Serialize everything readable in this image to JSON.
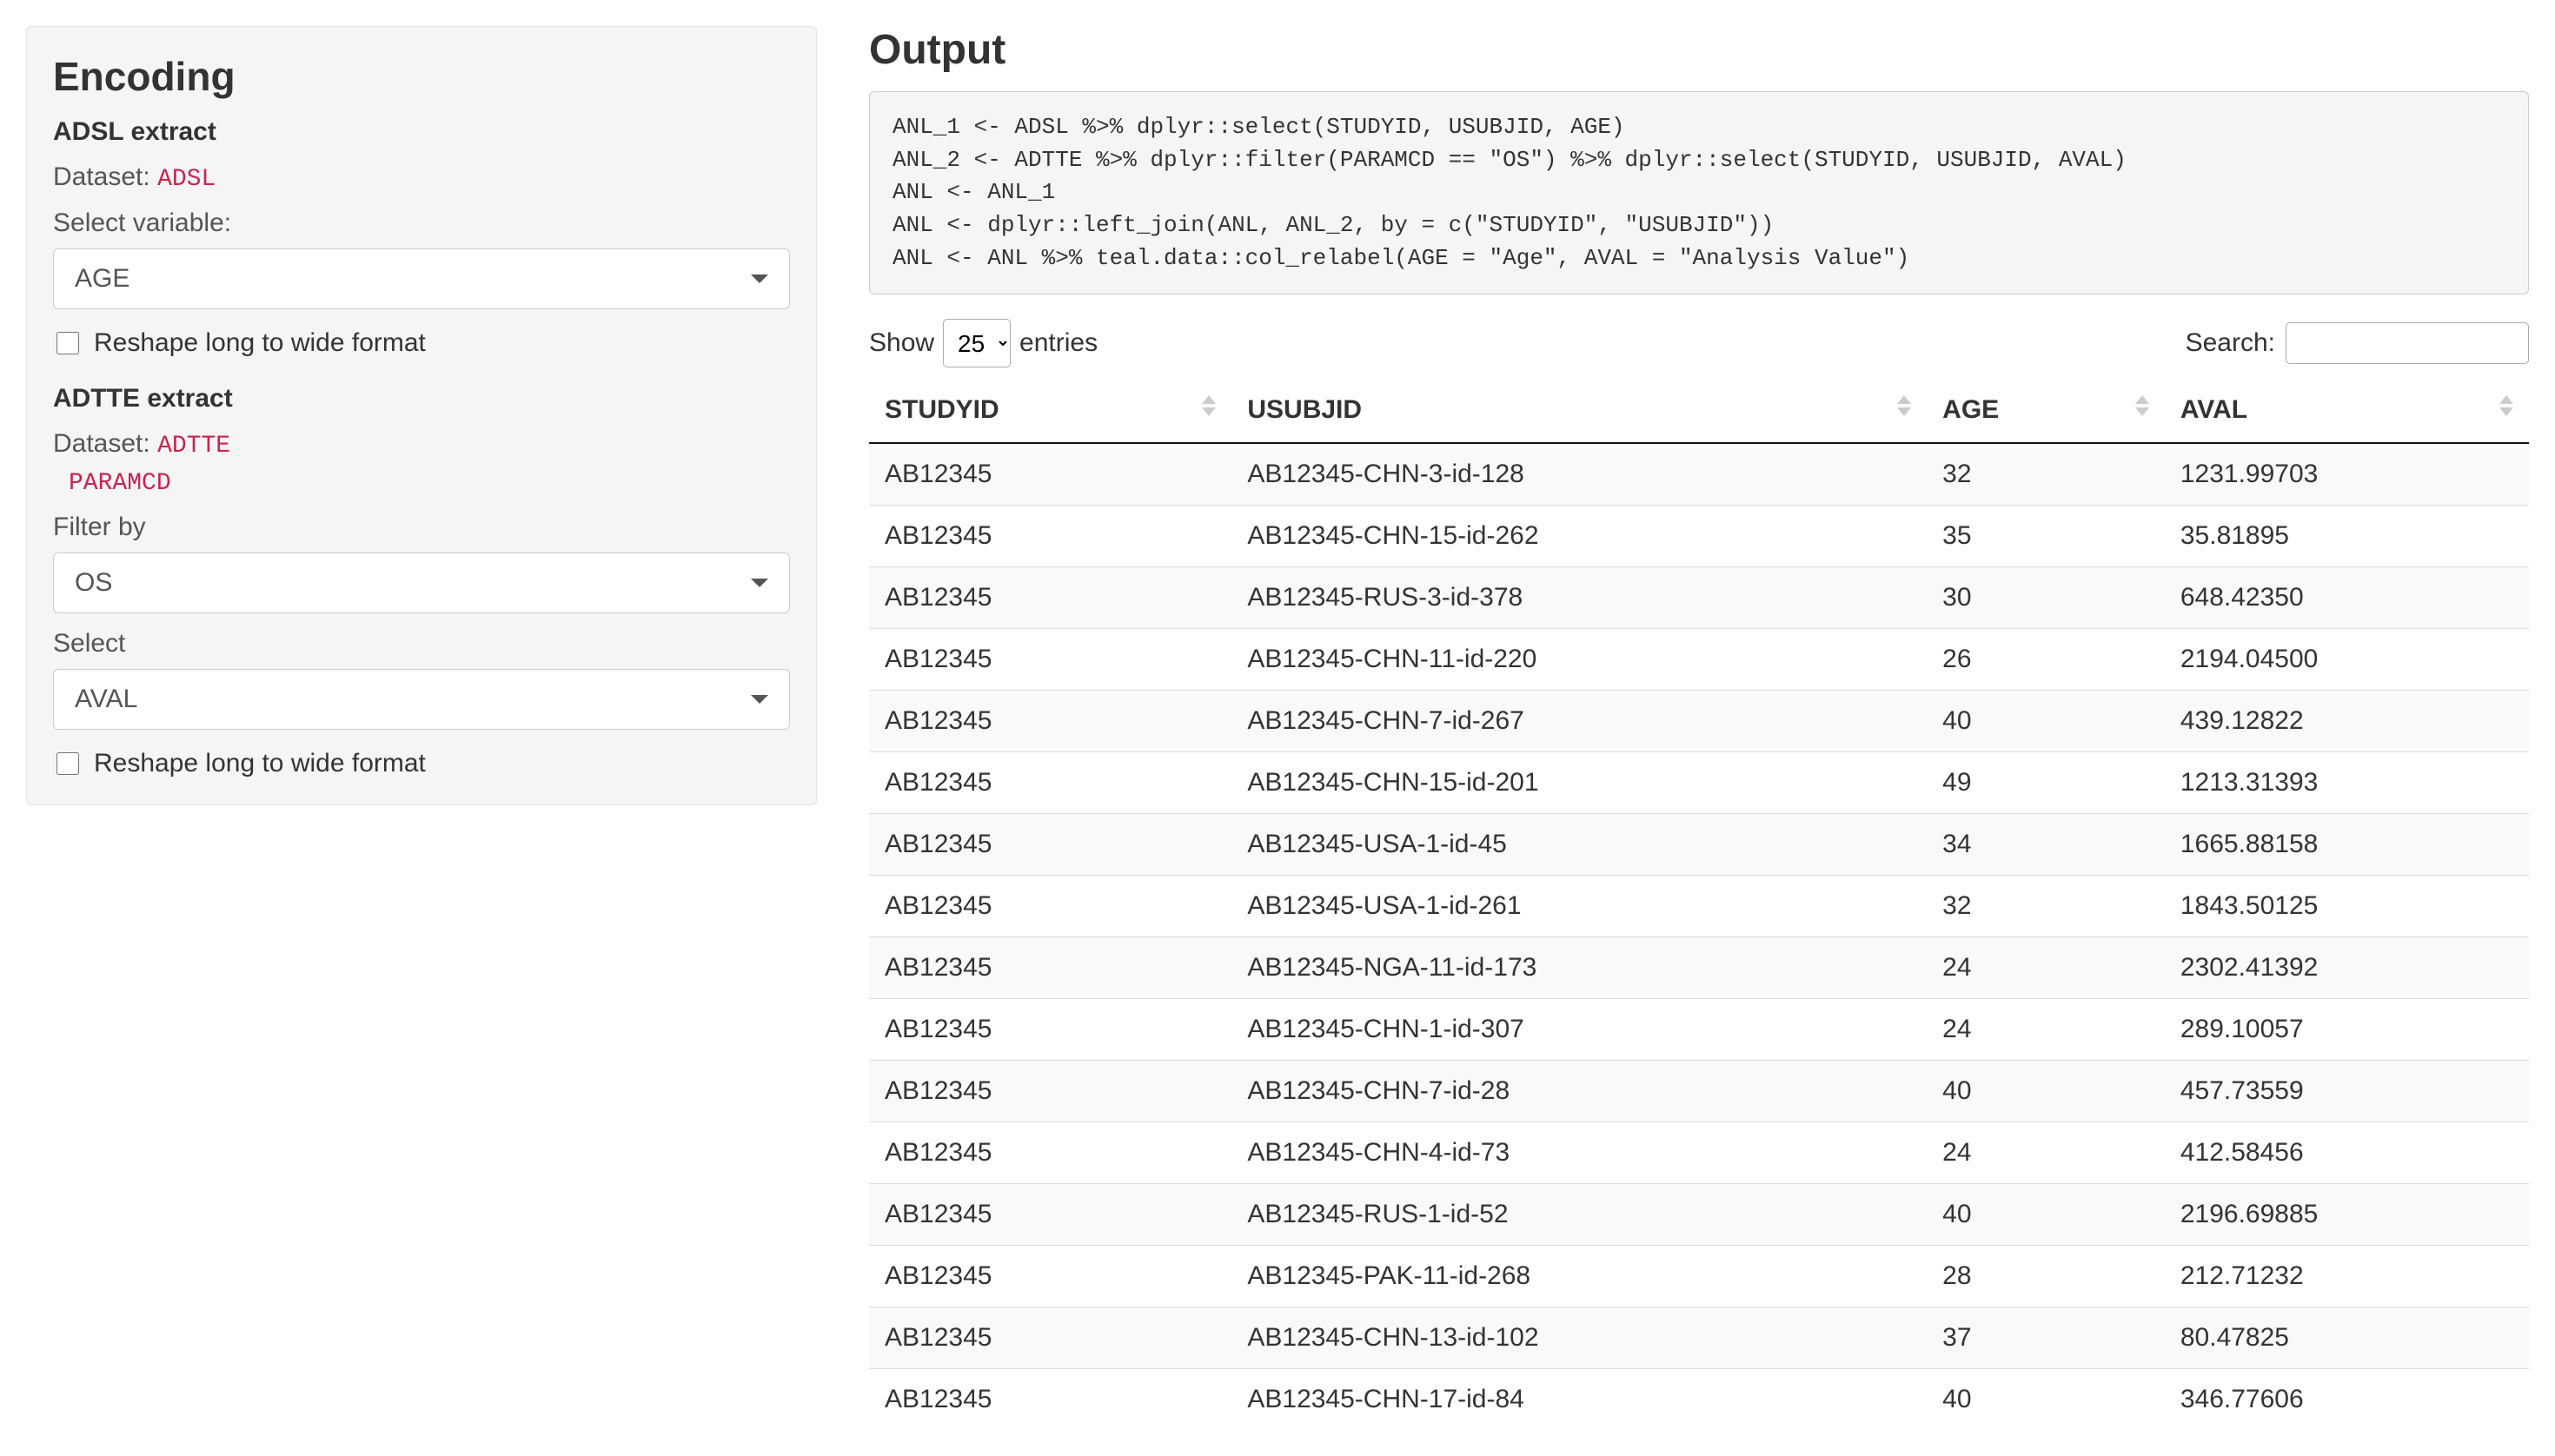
{
  "sidebar": {
    "title": "Encoding",
    "adsl": {
      "section_label": "ADSL extract",
      "dataset_label": "Dataset:",
      "dataset_value": "ADSL",
      "select_variable_label": "Select variable:",
      "select_variable_value": "AGE",
      "reshape_label": "Reshape long to wide format",
      "reshape_checked": false
    },
    "adtte": {
      "section_label": "ADTTE extract",
      "dataset_label": "Dataset:",
      "dataset_value": "ADTTE",
      "paramcd_chip": "PARAMCD",
      "filter_by_label": "Filter by",
      "filter_by_value": "OS",
      "select_label": "Select",
      "select_value": "AVAL",
      "reshape_label": "Reshape long to wide format",
      "reshape_checked": false
    }
  },
  "main": {
    "title": "Output",
    "code": "ANL_1 <- ADSL %>% dplyr::select(STUDYID, USUBJID, AGE)\nANL_2 <- ADTTE %>% dplyr::filter(PARAMCD == \"OS\") %>% dplyr::select(STUDYID, USUBJID, AVAL)\nANL <- ANL_1\nANL <- dplyr::left_join(ANL, ANL_2, by = c(\"STUDYID\", \"USUBJID\"))\nANL <- ANL %>% teal.data::col_relabel(AGE = \"Age\", AVAL = \"Analysis Value\")",
    "show_label_pre": "Show",
    "show_value": "25",
    "show_label_post": "entries",
    "search_label": "Search:",
    "search_value": "",
    "columns": [
      "STUDYID",
      "USUBJID",
      "AGE",
      "AVAL"
    ],
    "rows": [
      {
        "STUDYID": "AB12345",
        "USUBJID": "AB12345-CHN-3-id-128",
        "AGE": "32",
        "AVAL": "1231.99703"
      },
      {
        "STUDYID": "AB12345",
        "USUBJID": "AB12345-CHN-15-id-262",
        "AGE": "35",
        "AVAL": "35.81895"
      },
      {
        "STUDYID": "AB12345",
        "USUBJID": "AB12345-RUS-3-id-378",
        "AGE": "30",
        "AVAL": "648.42350"
      },
      {
        "STUDYID": "AB12345",
        "USUBJID": "AB12345-CHN-11-id-220",
        "AGE": "26",
        "AVAL": "2194.04500"
      },
      {
        "STUDYID": "AB12345",
        "USUBJID": "AB12345-CHN-7-id-267",
        "AGE": "40",
        "AVAL": "439.12822"
      },
      {
        "STUDYID": "AB12345",
        "USUBJID": "AB12345-CHN-15-id-201",
        "AGE": "49",
        "AVAL": "1213.31393"
      },
      {
        "STUDYID": "AB12345",
        "USUBJID": "AB12345-USA-1-id-45",
        "AGE": "34",
        "AVAL": "1665.88158"
      },
      {
        "STUDYID": "AB12345",
        "USUBJID": "AB12345-USA-1-id-261",
        "AGE": "32",
        "AVAL": "1843.50125"
      },
      {
        "STUDYID": "AB12345",
        "USUBJID": "AB12345-NGA-11-id-173",
        "AGE": "24",
        "AVAL": "2302.41392"
      },
      {
        "STUDYID": "AB12345",
        "USUBJID": "AB12345-CHN-1-id-307",
        "AGE": "24",
        "AVAL": "289.10057"
      },
      {
        "STUDYID": "AB12345",
        "USUBJID": "AB12345-CHN-7-id-28",
        "AGE": "40",
        "AVAL": "457.73559"
      },
      {
        "STUDYID": "AB12345",
        "USUBJID": "AB12345-CHN-4-id-73",
        "AGE": "24",
        "AVAL": "412.58456"
      },
      {
        "STUDYID": "AB12345",
        "USUBJID": "AB12345-RUS-1-id-52",
        "AGE": "40",
        "AVAL": "2196.69885"
      },
      {
        "STUDYID": "AB12345",
        "USUBJID": "AB12345-PAK-11-id-268",
        "AGE": "28",
        "AVAL": "212.71232"
      },
      {
        "STUDYID": "AB12345",
        "USUBJID": "AB12345-CHN-13-id-102",
        "AGE": "37",
        "AVAL": "80.47825"
      },
      {
        "STUDYID": "AB12345",
        "USUBJID": "AB12345-CHN-17-id-84",
        "AGE": "40",
        "AVAL": "346.77606"
      }
    ]
  }
}
